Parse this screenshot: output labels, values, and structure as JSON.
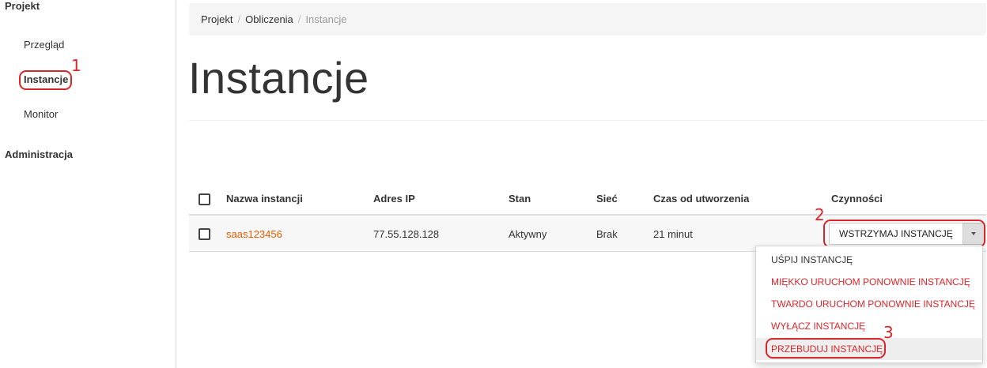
{
  "sidebar": {
    "project_title": "Projekt",
    "items": [
      {
        "label": "Przegląd"
      },
      {
        "label": "Instancje"
      },
      {
        "label": "Monitor"
      }
    ],
    "admin_title": "Administracja"
  },
  "breadcrumb": [
    "Projekt",
    "Obliczenia",
    "Instancje"
  ],
  "page_title": "Instancje",
  "table": {
    "headers": [
      "Nazwa instancji",
      "Adres IP",
      "Stan",
      "Sieć",
      "Czas od utworzenia",
      "Czynności"
    ],
    "rows": [
      {
        "name": "saas123456",
        "ip": "77.55.128.128",
        "status": "Aktywny",
        "network": "Brak",
        "age": "21 minut"
      }
    ]
  },
  "actions": {
    "primary_label": "WSTRZYMAJ INSTANCJĘ",
    "menu": [
      {
        "label": "UŚPIJ INSTANCJĘ",
        "style": "normal"
      },
      {
        "label": "MIĘKKO URUCHOM PONOWNIE INSTANCJĘ",
        "style": "danger"
      },
      {
        "label": "TWARDO URUCHOM PONOWNIE INSTANCJĘ",
        "style": "danger"
      },
      {
        "label": "WYŁĄCZ INSTANCJĘ",
        "style": "danger"
      },
      {
        "label": "PRZEBUDUJ INSTANCJĘ",
        "style": "danger"
      }
    ]
  },
  "annotations": [
    "1",
    "2",
    "3"
  ],
  "colors": {
    "annotation": "#d9262b",
    "link": "#e65c00",
    "danger": "#d9262b"
  }
}
